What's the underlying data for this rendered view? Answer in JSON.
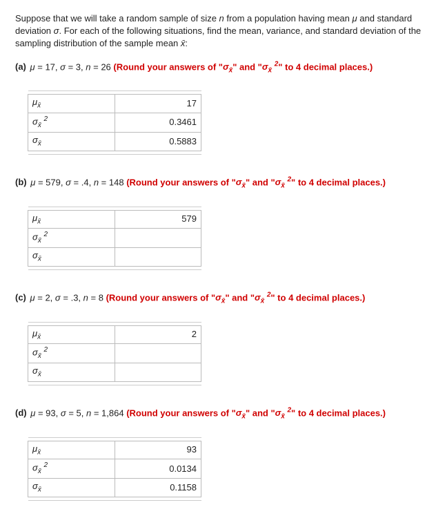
{
  "intro": {
    "text1": "Suppose that we will take a random sample of size ",
    "n": "n",
    "text2": " from a population having mean ",
    "mu": "μ",
    "text3": " and standard deviation ",
    "sigma": "σ",
    "text4": ". For each of the following situations, find the mean, variance, and standard deviation of the sampling distribution of the sample mean ",
    "xbar": "x̄",
    "colon": ":"
  },
  "rowLabels": {
    "mean_html": "μ<sub class=\"subx\">x̄</sub>",
    "var_html": "σ<sub class=\"subx\">x̄</sub> <sup class=\"sup2\">2</sup>",
    "sd_html": "σ<sub class=\"subx\">x̄</sub>"
  },
  "roundNote": {
    "open": " (Round your answers of \"",
    "sd_html": "σ<sub class=\"subx\">x̄</sub>",
    "mid": "\" and \"",
    "var_html": "σ<sub class=\"subx\">x̄</sub> <sup class=\"sup2\">2</sup>",
    "close": "\" to 4 decimal places.)"
  },
  "parts": {
    "a": {
      "label": "(a)",
      "given_html": "<span class=\"italic\">μ</span> = 17, <span class=\"italic\">σ</span> = 3, <span class=\"italic\">n</span> = 26",
      "mean": "17",
      "variance": "0.3461",
      "sd": "0.5883"
    },
    "b": {
      "label": "(b)",
      "given_html": "<span class=\"italic\">μ</span> = 579, <span class=\"italic\">σ</span> = .4, <span class=\"italic\">n</span> = 148",
      "mean": "579",
      "variance": "",
      "sd": ""
    },
    "c": {
      "label": "(c)",
      "given_html": "<span class=\"italic\">μ</span> = 2, <span class=\"italic\">σ</span> = .3, <span class=\"italic\">n</span> = 8",
      "mean": "2",
      "variance": "",
      "sd": ""
    },
    "d": {
      "label": "(d)",
      "given_html": "<span class=\"italic\">μ</span> = 93, <span class=\"italic\">σ</span> = 5, <span class=\"italic\">n</span> = 1,864",
      "mean": "93",
      "variance": "0.0134",
      "sd": "0.1158"
    }
  }
}
